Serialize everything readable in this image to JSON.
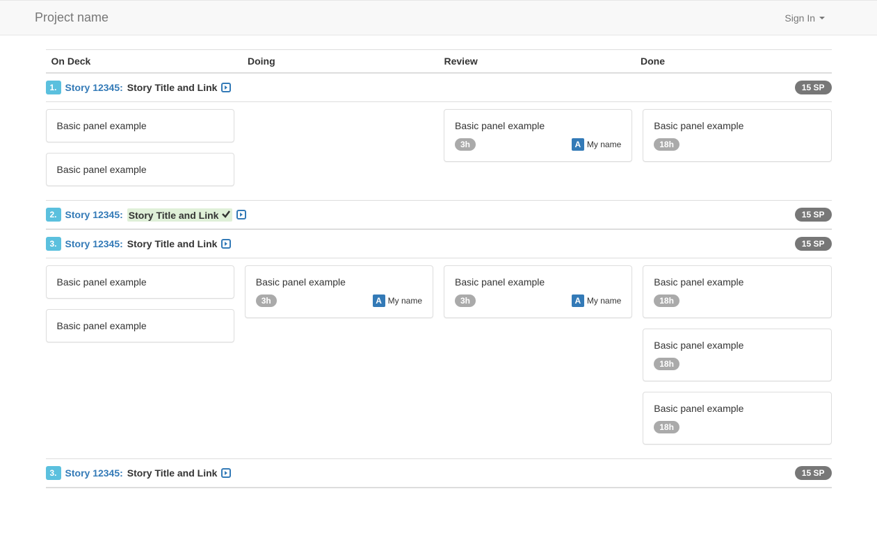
{
  "navbar": {
    "brand": "Project name",
    "signin": "Sign In"
  },
  "columns": [
    "On Deck",
    "Doing",
    "Review",
    "Done"
  ],
  "stories": [
    {
      "num": "1.",
      "link": "Story 12345:",
      "title": "Story Title and Link",
      "highlighted": false,
      "check": false,
      "sp": "15 SP",
      "cols": [
        [
          {
            "text": "Basic panel example"
          },
          {
            "text": "Basic panel example"
          }
        ],
        [],
        [
          {
            "text": "Basic panel example",
            "time": "3h",
            "avatar": "A",
            "name": "My name"
          }
        ],
        [
          {
            "text": "Basic panel example",
            "time": "18h"
          }
        ]
      ]
    },
    {
      "num": "2.",
      "link": "Story 12345:",
      "title": "Story Title and Link",
      "highlighted": true,
      "check": true,
      "sp": "15 SP",
      "cols": null
    },
    {
      "num": "3.",
      "link": "Story 12345:",
      "title": "Story Title and Link",
      "highlighted": false,
      "check": false,
      "sp": "15 SP",
      "cols": [
        [
          {
            "text": "Basic panel example"
          },
          {
            "text": "Basic panel example"
          }
        ],
        [
          {
            "text": "Basic panel example",
            "time": "3h",
            "avatar": "A",
            "name": "My name"
          }
        ],
        [
          {
            "text": "Basic panel example",
            "time": "3h",
            "avatar": "A",
            "name": "My name"
          }
        ],
        [
          {
            "text": "Basic panel example",
            "time": "18h"
          },
          {
            "text": "Basic panel example",
            "time": "18h"
          },
          {
            "text": "Basic panel example",
            "time": "18h"
          }
        ]
      ]
    },
    {
      "num": "3.",
      "link": "Story 12345:",
      "title": "Story Title and Link",
      "highlighted": false,
      "check": false,
      "sp": "15 SP",
      "cols": null
    }
  ]
}
